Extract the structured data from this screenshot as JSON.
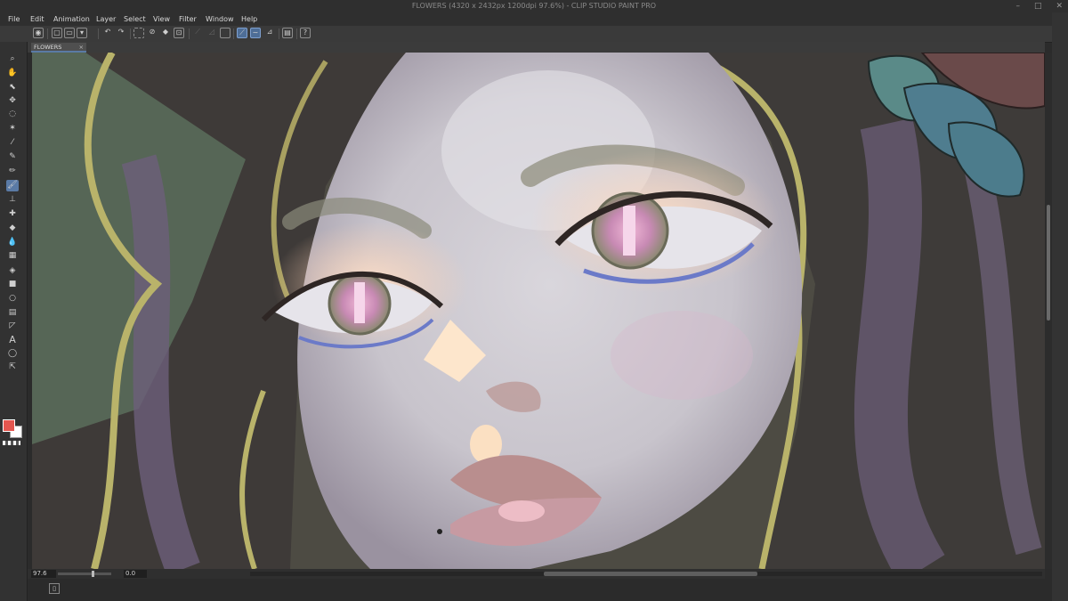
{
  "window": {
    "title": "FLOWERS (4320 x 2432px 1200dpi 97.6%) - CLIP STUDIO PAINT PRO",
    "controls": [
      "–",
      "□",
      "✕"
    ]
  },
  "menu": [
    "File",
    "Edit",
    "Animation",
    "Layer",
    "Select",
    "View",
    "Filter",
    "Window",
    "Help"
  ],
  "command_icons": [
    "layers-icon",
    "new-file-icon",
    "open-folder-icon",
    "save-icon",
    "undo-icon",
    "redo-icon",
    "lasso-select-icon",
    "clear-icon",
    "fill-icon",
    "transform-icon",
    "deselect-icon",
    "ruler-icon",
    "pen-active-icon",
    "brush-active-icon",
    "vector-icon",
    "settings-icon",
    "help-icon"
  ],
  "tools": [
    {
      "name": "zoom-icon",
      "glyph": "⌕"
    },
    {
      "name": "hand-icon",
      "glyph": "✋"
    },
    {
      "name": "operation-icon",
      "glyph": "⬉"
    },
    {
      "name": "move-icon",
      "glyph": "✥"
    },
    {
      "name": "lasso-icon",
      "glyph": "◌"
    },
    {
      "name": "magic-wand-icon",
      "glyph": "✶"
    },
    {
      "name": "eyedropper-icon",
      "glyph": "⁄"
    },
    {
      "name": "pen-icon",
      "glyph": "✎"
    },
    {
      "name": "pencil-icon",
      "glyph": "✏"
    },
    {
      "name": "brush-icon",
      "glyph": "🖌"
    },
    {
      "name": "airbrush-icon",
      "glyph": "⊥"
    },
    {
      "name": "decoration-icon",
      "glyph": "✚"
    },
    {
      "name": "eraser-icon",
      "glyph": "◆"
    },
    {
      "name": "blend-icon",
      "glyph": "💧"
    },
    {
      "name": "fill-tool-icon",
      "glyph": "▦"
    },
    {
      "name": "bucket-icon",
      "glyph": "◈"
    },
    {
      "name": "gradient-icon",
      "glyph": "■"
    },
    {
      "name": "figure-icon",
      "glyph": "○"
    },
    {
      "name": "frame-icon",
      "glyph": "▤"
    },
    {
      "name": "ruler-tool-icon",
      "glyph": "◸"
    },
    {
      "name": "text-icon",
      "glyph": "A"
    },
    {
      "name": "balloon-icon",
      "glyph": "◯"
    },
    {
      "name": "correct-line-icon",
      "glyph": "⇱"
    }
  ],
  "colors": {
    "main": "#e4564f",
    "sub": "#ffffff",
    "accent": "#5a7aa5"
  },
  "tab": {
    "label": "FLOWERS",
    "close": "×"
  },
  "status": {
    "zoom": "97.6",
    "rotation": "0.0"
  }
}
